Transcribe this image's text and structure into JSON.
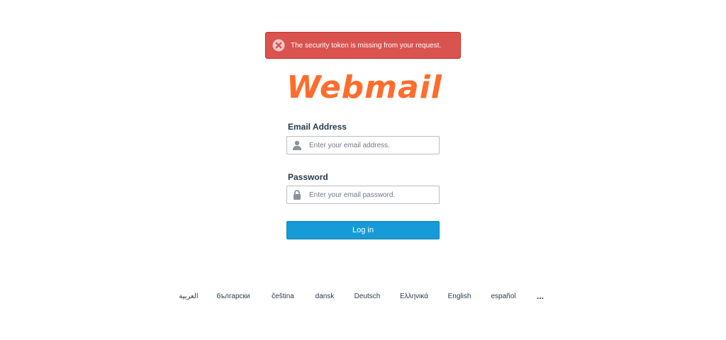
{
  "alert": {
    "message": "The security token is missing from your request.",
    "icon": "error-circle-icon",
    "color": "#d9534f"
  },
  "logo": {
    "text": "Webmail",
    "color": "#ff6c2c"
  },
  "form": {
    "email_label": "Email Address",
    "email_placeholder": "Enter your email address.",
    "email_icon": "user-icon",
    "password_label": "Password",
    "password_placeholder": "Enter your email password.",
    "password_icon": "lock-icon",
    "login_label": "Log in",
    "button_color": "#179bd7"
  },
  "languages": {
    "items": [
      "العربية",
      "български",
      "čeština",
      "dansk",
      "Deutsch",
      "Ελληνικά",
      "English",
      "español"
    ],
    "more": "..."
  }
}
